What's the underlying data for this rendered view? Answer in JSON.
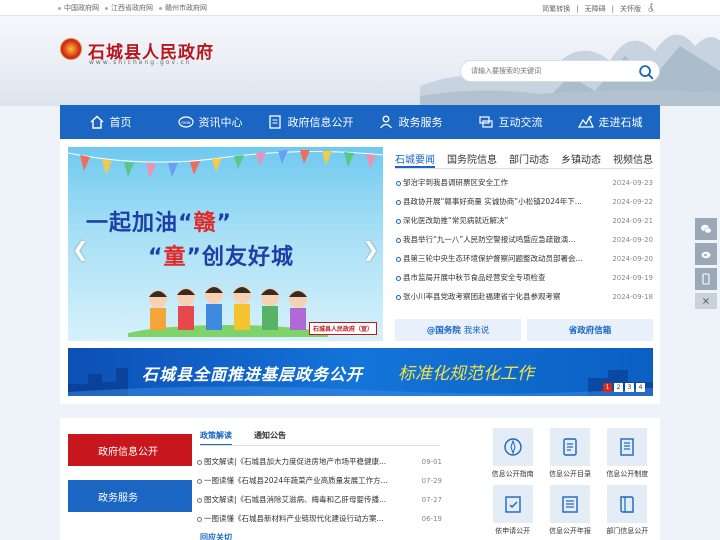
{
  "topbar": {
    "links": [
      "中国政府网",
      "江西省政府网",
      "赣州市政府网"
    ],
    "right": [
      "简繁转换",
      "无障碍",
      "关怀版"
    ]
  },
  "header": {
    "title": "石城县人民政府",
    "domain": "www.shicheng.gov.cn",
    "search_placeholder": "请输入要搜索的关键词"
  },
  "nav": [
    {
      "label": "首页",
      "icon": "home-icon"
    },
    {
      "label": "资讯中心",
      "icon": "news-icon"
    },
    {
      "label": "政府信息公开",
      "icon": "document-icon"
    },
    {
      "label": "政务服务",
      "icon": "people-icon"
    },
    {
      "label": "互动交流",
      "icon": "chat-icon"
    },
    {
      "label": "走进石城",
      "icon": "landscape-icon"
    }
  ],
  "carousel": {
    "slogan1_a": "一起加油“",
    "slogan1_b": "赣",
    "slogan1_c": "”",
    "slogan2_a": "“",
    "slogan2_b": "童",
    "slogan2_c": "”创友好城",
    "caption": "石城县人民政府（宣）"
  },
  "news": {
    "tabs": [
      "石城要闻",
      "国务院信息",
      "部门动态",
      "乡镇动态",
      "视频信息"
    ],
    "items": [
      {
        "title": "邹治宇到我县调研票区安全工作",
        "date": "2024-09-23"
      },
      {
        "title": "县政协开展“赣事好商量 实诚协商”小松镇2024年下...",
        "date": "2024-09-22"
      },
      {
        "title": "深化医改助推“常见病就近解决”",
        "date": "2024-09-21"
      },
      {
        "title": "我县举行“九一八”人民防空警报试鸣暨应急疏散演...",
        "date": "2024-09-20"
      },
      {
        "title": "县第三轮中央生态环境保护督察问题整改动员部署会...",
        "date": "2024-09-20"
      },
      {
        "title": "县市监局开展中秋节食品经营安全专项检查",
        "date": "2024-09-19"
      },
      {
        "title": "张小川率县党政考察团赴福建省宁化县参观考察",
        "date": "2024-09-18"
      }
    ],
    "quick": [
      {
        "prefix": "@国务院",
        "label": "我来说"
      },
      {
        "prefix": "",
        "label": "省政府信箱"
      }
    ]
  },
  "banner2": {
    "text": "石城县全面推进基层政务公开",
    "text2": "标准化规范化工作",
    "pages": [
      "1",
      "2",
      "3",
      "4"
    ]
  },
  "bottom": {
    "menu": [
      "政府信息公开",
      "政务服务"
    ],
    "tabs": [
      "政策解读",
      "通知公告"
    ],
    "items": [
      {
        "title": "图文解读|《石城县加大力度促进房地产市场平稳健康...",
        "date": "09-01"
      },
      {
        "title": "一图读懂《石城县2024年蔬菜产业高质量发展工作方...",
        "date": "07-29"
      },
      {
        "title": "图文解读|《石城县消除艾滋病、梅毒和乙肝母婴传播...",
        "date": "07-27"
      },
      {
        "title": "一图读懂《石城县新材料产业链现代化建设行动方案...",
        "date": "06-19"
      }
    ],
    "more_label": "回应关切",
    "grid": [
      {
        "label": "信息公开指南",
        "icon": "compass-icon"
      },
      {
        "label": "信息公开目录",
        "icon": "list-icon"
      },
      {
        "label": "信息公开制度",
        "icon": "rules-icon"
      },
      {
        "label": "依申请公开",
        "icon": "apply-icon"
      },
      {
        "label": "信息公开年报",
        "icon": "report-icon"
      },
      {
        "label": "部门信息公开",
        "icon": "book-icon"
      }
    ]
  },
  "colors": {
    "nav_blue": "#1a66c2",
    "title_red": "#b8161a",
    "menu_red": "#c8171c"
  }
}
